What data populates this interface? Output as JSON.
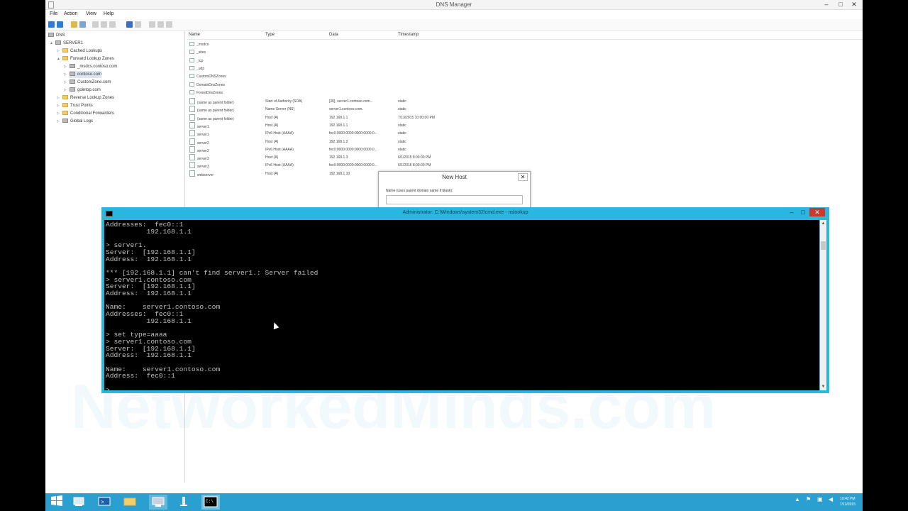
{
  "window": {
    "title": "DNS Manager",
    "minimize": "–",
    "maximize": "□",
    "close": "✕"
  },
  "menu": [
    "File",
    "Action",
    "View",
    "Help"
  ],
  "tree": {
    "items": [
      {
        "label": "DNS",
        "icon": "dns-icon"
      },
      {
        "label": "SERVER1",
        "icon": "server-icon"
      },
      {
        "label": "Cached Lookups",
        "icon": "folder-icon"
      },
      {
        "label": "Forward Lookup Zones",
        "icon": "folder-icon"
      },
      {
        "label": "_msdcs.contoso.com",
        "icon": "zone-icon"
      },
      {
        "label": "contoso.com",
        "icon": "zone-icon"
      },
      {
        "label": "CustomZone.com",
        "icon": "zone-icon"
      },
      {
        "label": "gointop.com",
        "icon": "zone-icon"
      },
      {
        "label": "Reverse Lookup Zones",
        "icon": "folder-icon"
      },
      {
        "label": "Trust Points",
        "icon": "folder-icon"
      },
      {
        "label": "Conditional Forwarders",
        "icon": "folder-icon"
      },
      {
        "label": "Global Logs",
        "icon": "logs-icon"
      }
    ]
  },
  "list": {
    "columns": [
      "Name",
      "Type",
      "Data",
      "Timestamp"
    ],
    "folders": [
      "_msdcs",
      "_sites",
      "_tcp",
      "_udp",
      "CustomDNSZones",
      "DomainDnsZones",
      "ForestDnsZones"
    ],
    "records": [
      {
        "name": "(same as parent folder)",
        "type": "Start of Authority (SOA)",
        "data": "[30], server1.contoso.com...",
        "ts": "static"
      },
      {
        "name": "(same as parent folder)",
        "type": "Name Server (NS)",
        "data": "server1.contoso.com.",
        "ts": "static"
      },
      {
        "name": "(same as parent folder)",
        "type": "Host (A)",
        "data": "192.168.1.1",
        "ts": "7/13/2015 10:00:00 PM"
      },
      {
        "name": "server1",
        "type": "Host (A)",
        "data": "192.168.1.1",
        "ts": "static"
      },
      {
        "name": "server1",
        "type": "IPv6 Host (AAAA)",
        "data": "fec0:0000:0000:0000:0000:0...",
        "ts": "static"
      },
      {
        "name": "server2",
        "type": "Host (A)",
        "data": "192.168.1.2",
        "ts": "static"
      },
      {
        "name": "server2",
        "type": "IPv6 Host (AAAA)",
        "data": "fec0:0000:0000:0000:0000:0...",
        "ts": "static"
      },
      {
        "name": "server3",
        "type": "Host (A)",
        "data": "192.168.1.3",
        "ts": "6/1/2015 8:00:00 PM"
      },
      {
        "name": "server3",
        "type": "IPv6 Host (AAAA)",
        "data": "fec0:0000:0000:0000:0000:0...",
        "ts": "6/1/2015 8:00:00 PM"
      },
      {
        "name": "webserver",
        "type": "Host (A)",
        "data": "192.168.1.10",
        "ts": ""
      }
    ]
  },
  "dialog": {
    "title": "New Host",
    "close": "✕",
    "name_label": "Name (uses parent domain name if blank):"
  },
  "cmd": {
    "title": "Administrator: C:\\Windows\\system32\\cmd.exe - nslookup",
    "output": "Addresses:  fec0::1\n          192.168.1.1\n\n> server1.\nServer:  [192.168.1.1]\nAddress:  192.168.1.1\n\n*** [192.168.1.1] can't find server1.: Server failed\n> server1.contoso.com\nServer:  [192.168.1.1]\nAddress:  192.168.1.1\n\nName:    server1.contoso.com\nAddresses:  fec0::1\n          192.168.1.1\n\n> set type=aaaa\n> server1.contoso.com\nServer:  [192.168.1.1]\nAddress:  192.168.1.1\n\nName:    server1.contoso.com\nAddress:  fec0::1\n\n> _"
  },
  "watermark": "NetworkedMinds.com",
  "taskbar": {
    "items": [
      "start-icon",
      "server-manager-icon",
      "powershell-icon",
      "file-explorer-icon",
      "dns-manager-icon",
      "network-icon",
      "cmd-icon"
    ],
    "clock_time": "10:42 PM",
    "clock_date": "7/13/2015"
  }
}
